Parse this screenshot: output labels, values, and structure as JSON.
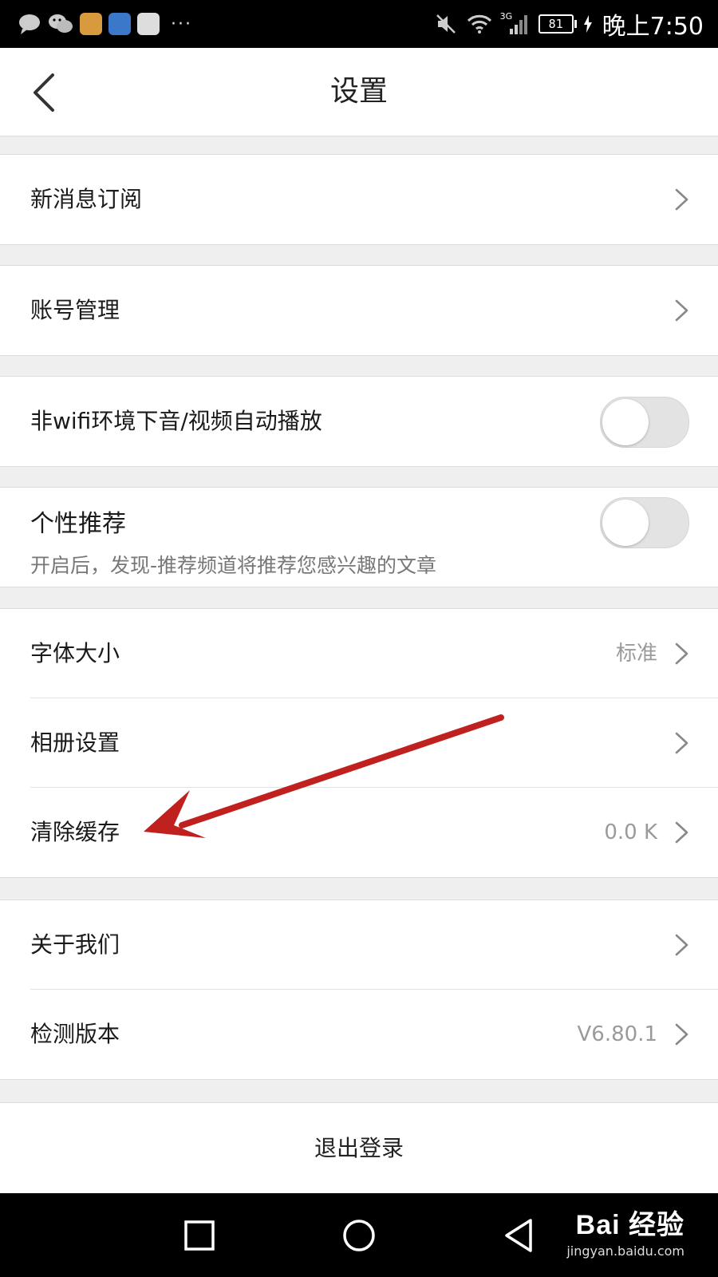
{
  "status_bar": {
    "time": "晚上7:50",
    "battery": "81",
    "network": "3G"
  },
  "header": {
    "title": "设置"
  },
  "sections": {
    "subscribe": {
      "label": "新消息订阅"
    },
    "account": {
      "label": "账号管理"
    },
    "autoplay": {
      "label": "非wifi环境下音/视频自动播放",
      "enabled": false
    },
    "recommend": {
      "label": "个性推荐",
      "description": "开启后，发现-推荐频道将推荐您感兴趣的文章",
      "enabled": false
    },
    "general": {
      "font_size": {
        "label": "字体大小",
        "value": "标准"
      },
      "album": {
        "label": "相册设置"
      },
      "cache": {
        "label": "清除缓存",
        "value": "0.0 K"
      }
    },
    "about": {
      "about_us": {
        "label": "关于我们"
      },
      "version": {
        "label": "检测版本",
        "value": "V6.80.1"
      }
    }
  },
  "logout": {
    "label": "退出登录"
  },
  "watermark": {
    "brand": "Bai 经验",
    "url": "jingyan.baidu.com"
  },
  "colors": {
    "annotation_arrow": "#c0201e",
    "toggle_off": "#e3e3e3"
  }
}
